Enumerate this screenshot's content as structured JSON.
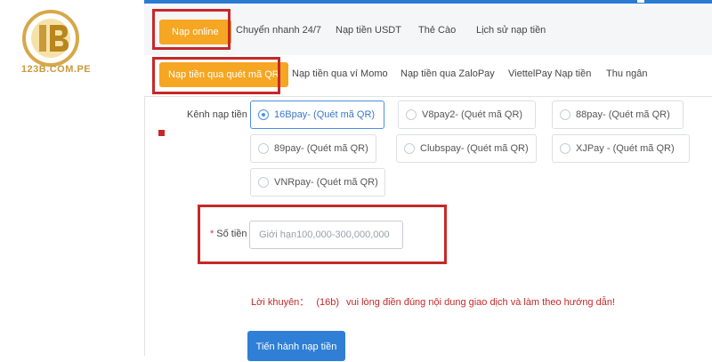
{
  "brand": {
    "logo_text": "123B.COM.PE"
  },
  "main_tabs": [
    {
      "label": "Nạp online",
      "active": true
    },
    {
      "label": "Chuyển nhanh 24/7"
    },
    {
      "label": "Nạp tiền USDT"
    },
    {
      "label": "Thẻ Cào"
    },
    {
      "label": "Lịch sử nạp tiền"
    }
  ],
  "sub_tabs": [
    {
      "label": "Nạp tiền qua quét mã QR",
      "active": true
    },
    {
      "label": "Nạp tiền qua ví Momo"
    },
    {
      "label": "Nạp tiền qua ZaloPay"
    },
    {
      "label": "ViettelPay Nạp tiền"
    },
    {
      "label": "Thu ngân"
    }
  ],
  "channel": {
    "label": "Kênh nạp tiền",
    "options": [
      {
        "label": "16Bpay-  (Quét mã QR)",
        "selected": true
      },
      {
        "label": "V8pay2-  (Quét mã QR)"
      },
      {
        "label": "88pay-  (Quét mã QR)"
      },
      {
        "label": "89pay-  (Quét mã QR)"
      },
      {
        "label": "Clubspay-  (Quét mã QR)"
      },
      {
        "label": "XJPay -  (Quét mã QR)"
      },
      {
        "label": "VNRpay-  (Quét mã QR)"
      }
    ]
  },
  "amount": {
    "required_mark": "*",
    "label": "Số tiền",
    "placeholder": "Giới hạn100,000-300,000,000",
    "value": ""
  },
  "advice": {
    "label": "Lời khuyên：",
    "code": "(16b)",
    "text": "vui lòng điền đúng nội dung giao dịch và làm theo hướng dẫn!"
  },
  "submit_label": "Tiến hành nạp tiền",
  "colors": {
    "accent_orange": "#f5a623",
    "highlight_red": "#c62828",
    "primary_blue": "#2f7fd6",
    "logo_gold": "#c99a3a"
  }
}
